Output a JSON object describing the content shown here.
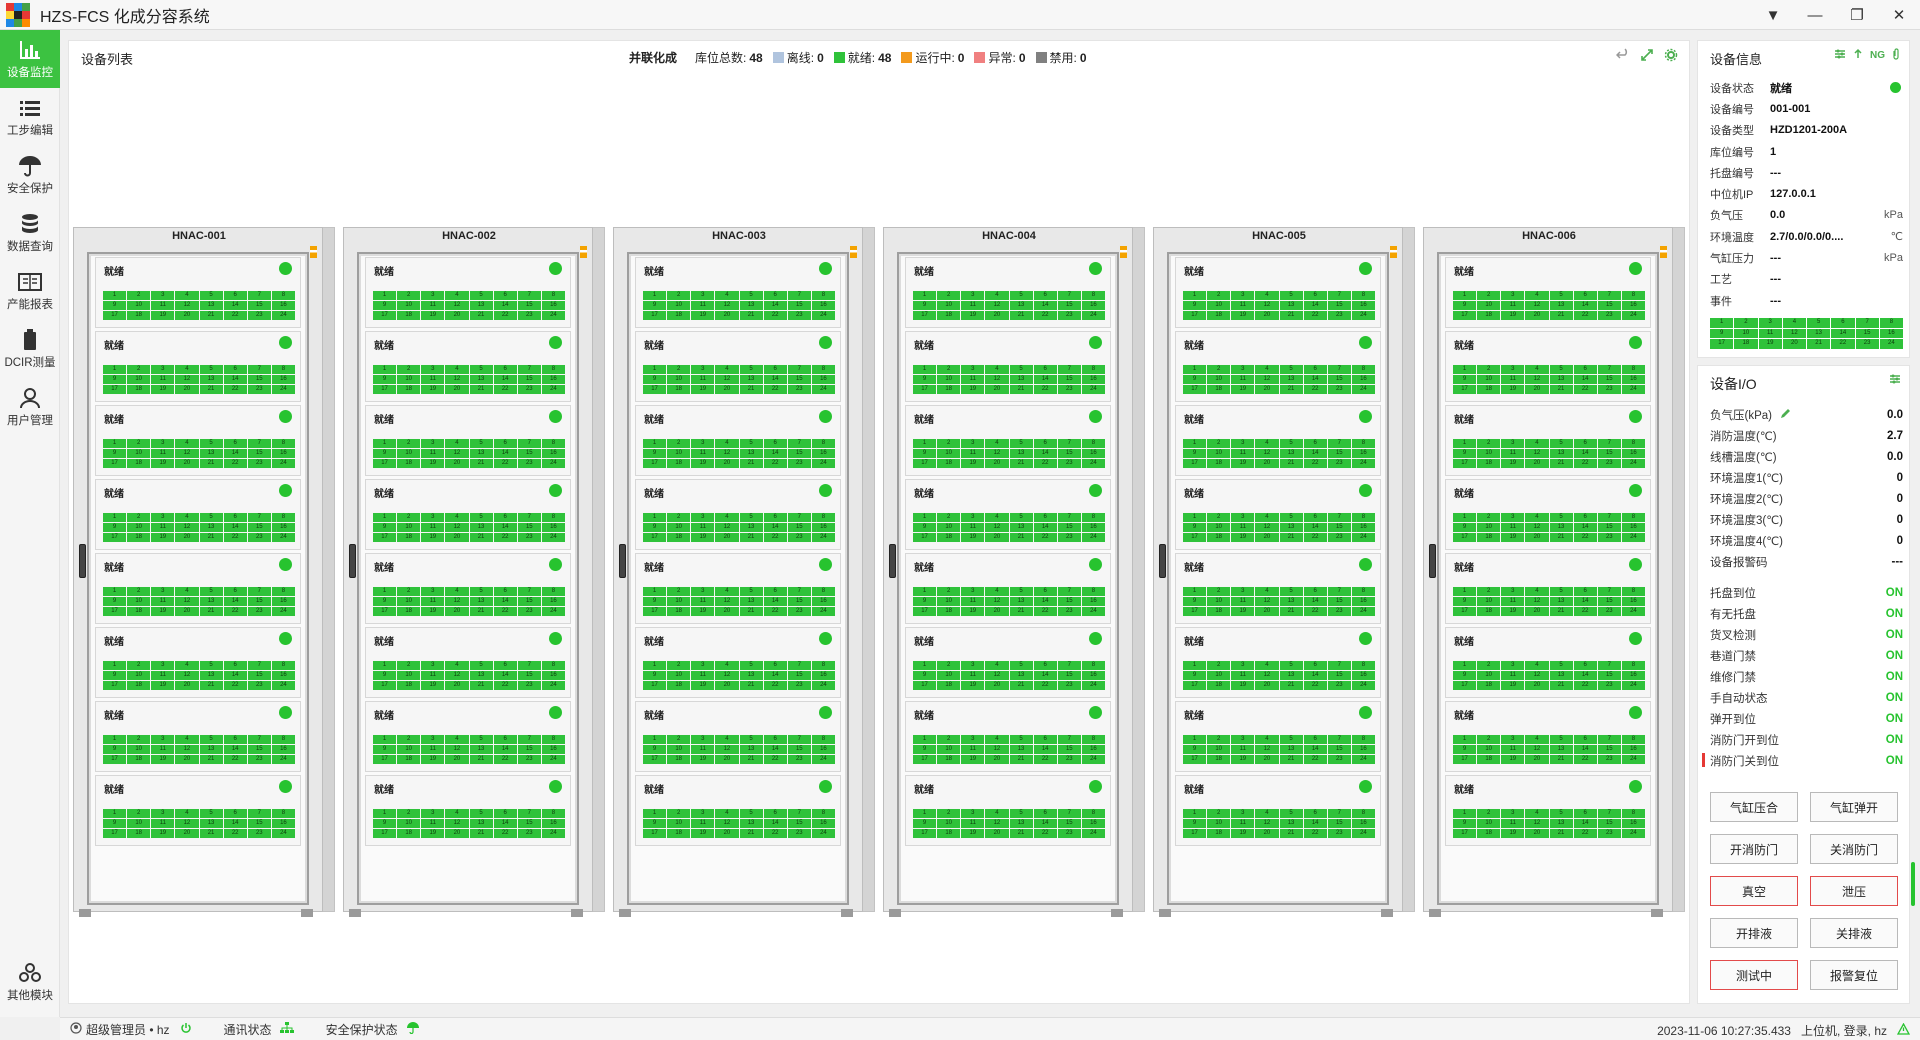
{
  "app": {
    "title": "HZS-FCS 化成分容系统"
  },
  "nav": [
    {
      "label": "设备监控",
      "icon": "bar-chart-icon",
      "active": true
    },
    {
      "label": "工步编辑",
      "icon": "list-icon"
    },
    {
      "label": "安全保护",
      "icon": "umbrella-icon"
    },
    {
      "label": "数据查询",
      "icon": "database-icon"
    },
    {
      "label": "产能报表",
      "icon": "report-icon"
    },
    {
      "label": "DCIR测量",
      "icon": "battery-icon"
    },
    {
      "label": "用户管理",
      "icon": "user-icon"
    }
  ],
  "nav_bottom": {
    "label": "其他模块",
    "icon": "modules-icon"
  },
  "device_list": {
    "title": "设备列表",
    "mode": "并联化成",
    "stats": [
      {
        "label": "库位总数:",
        "value": "48",
        "color": ""
      },
      {
        "label": "离线:",
        "value": "0",
        "color": "#b0c4de"
      },
      {
        "label": "就绪:",
        "value": "48",
        "color": "#2fc23a"
      },
      {
        "label": "运行中:",
        "value": "0",
        "color": "#f39a1d"
      },
      {
        "label": "异常:",
        "value": "0",
        "color": "#f08080"
      },
      {
        "label": "禁用:",
        "value": "0",
        "color": "#808080"
      }
    ]
  },
  "cabinets": [
    {
      "name": "HNAC-001"
    },
    {
      "name": "HNAC-002"
    },
    {
      "name": "HNAC-003"
    },
    {
      "name": "HNAC-004"
    },
    {
      "name": "HNAC-005"
    },
    {
      "name": "HNAC-006"
    }
  ],
  "slot_status": "就绪",
  "cell_numbers": [
    "1",
    "2",
    "3",
    "4",
    "5",
    "6",
    "7",
    "8",
    "9",
    "10",
    "11",
    "12",
    "13",
    "14",
    "15",
    "16",
    "17",
    "18",
    "19",
    "20",
    "21",
    "22",
    "23",
    "24"
  ],
  "device_info": {
    "title": "设备信息",
    "ng_label": "NG",
    "rows": [
      {
        "k": "设备状态",
        "v": "就绪",
        "u": "",
        "dot": true
      },
      {
        "k": "设备编号",
        "v": "001-001",
        "u": ""
      },
      {
        "k": "设备类型",
        "v": "HZD1201-200A",
        "u": ""
      },
      {
        "k": "库位编号",
        "v": "1",
        "u": ""
      },
      {
        "k": "托盘编号",
        "v": "---",
        "u": ""
      },
      {
        "k": "中位机IP",
        "v": "127.0.0.1",
        "u": ""
      },
      {
        "k": "负气压",
        "v": "0.0",
        "u": "kPa"
      },
      {
        "k": "环境温度",
        "v": "2.7/0.0/0.0/0....",
        "u": "℃"
      },
      {
        "k": "气缸压力",
        "v": "---",
        "u": "kPa"
      },
      {
        "k": "工艺",
        "v": "---",
        "u": ""
      },
      {
        "k": "事件",
        "v": "---",
        "u": ""
      }
    ]
  },
  "device_io": {
    "title": "设备I/O",
    "values": [
      {
        "k": "负气压(kPa)",
        "v": "0.0",
        "edit": true
      },
      {
        "k": "消防温度(℃)",
        "v": "2.7"
      },
      {
        "k": "线槽温度(℃)",
        "v": "0.0"
      },
      {
        "k": "环境温度1(℃)",
        "v": "0"
      },
      {
        "k": "环境温度2(℃)",
        "v": "0"
      },
      {
        "k": "环境温度3(℃)",
        "v": "0"
      },
      {
        "k": "环境温度4(℃)",
        "v": "0"
      },
      {
        "k": "设备报警码",
        "v": "---"
      }
    ],
    "signals": [
      {
        "k": "托盘到位",
        "v": "ON"
      },
      {
        "k": "有无托盘",
        "v": "ON"
      },
      {
        "k": "货叉检测",
        "v": "ON"
      },
      {
        "k": "巷道门禁",
        "v": "ON"
      },
      {
        "k": "维修门禁",
        "v": "ON"
      },
      {
        "k": "手自动状态",
        "v": "ON"
      },
      {
        "k": "弹开到位",
        "v": "ON"
      },
      {
        "k": "消防门开到位",
        "v": "ON"
      },
      {
        "k": "消防门关到位",
        "v": "ON"
      }
    ],
    "buttons": [
      {
        "label": "气缸压合",
        "red": false,
        "name": "cylinder-press-button"
      },
      {
        "label": "气缸弹开",
        "red": false,
        "name": "cylinder-release-button"
      },
      {
        "label": "开消防门",
        "red": false,
        "name": "open-fire-door-button"
      },
      {
        "label": "关消防门",
        "red": false,
        "name": "close-fire-door-button"
      },
      {
        "label": "真空",
        "red": true,
        "name": "vacuum-button"
      },
      {
        "label": "泄压",
        "red": true,
        "name": "pressure-relief-button"
      },
      {
        "label": "开排液",
        "red": false,
        "name": "open-drain-button"
      },
      {
        "label": "关排液",
        "red": false,
        "name": "close-drain-button"
      },
      {
        "label": "测试中",
        "red": true,
        "name": "testing-button"
      },
      {
        "label": "报警复位",
        "red": false,
        "name": "alarm-reset-button"
      }
    ]
  },
  "statusbar": {
    "user": "超级管理员 • hz",
    "comm": "通讯状态",
    "safety": "安全保护状态",
    "datetime": "2023-11-06 10:27:35.433",
    "login": "上位机, 登录, hz"
  }
}
